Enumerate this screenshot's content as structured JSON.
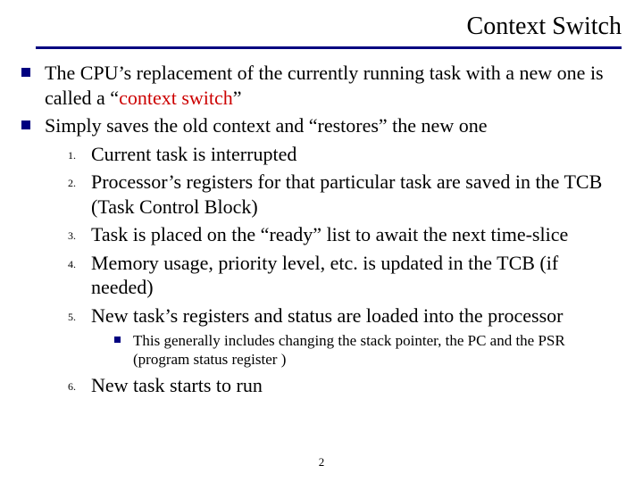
{
  "title": "Context Switch",
  "bullets": [
    {
      "pre": "The CPU’s replacement of the currently running task with a new one is called a “",
      "accent": "context switch",
      "post": "”"
    },
    {
      "pre": "Simply saves the old context and “restores” the new one",
      "accent": "",
      "post": ""
    }
  ],
  "steps": [
    {
      "n": "1.",
      "t": "Current task is interrupted"
    },
    {
      "n": "2.",
      "t": "Processor’s registers for that particular task are saved in the TCB (Task Control Block)"
    },
    {
      "n": "3.",
      "t": "Task is placed on the “ready” list to await the next time-slice"
    },
    {
      "n": "4.",
      "t": "Memory usage, priority level, etc. is updated in the TCB (if needed)"
    },
    {
      "n": "5.",
      "t": "New task’s registers and status are loaded into the processor"
    }
  ],
  "substep": "This generally includes changing the stack pointer, the PC and the PSR (program status register )",
  "step6": {
    "n": "6.",
    "t": "New task starts to run"
  },
  "page": "2"
}
